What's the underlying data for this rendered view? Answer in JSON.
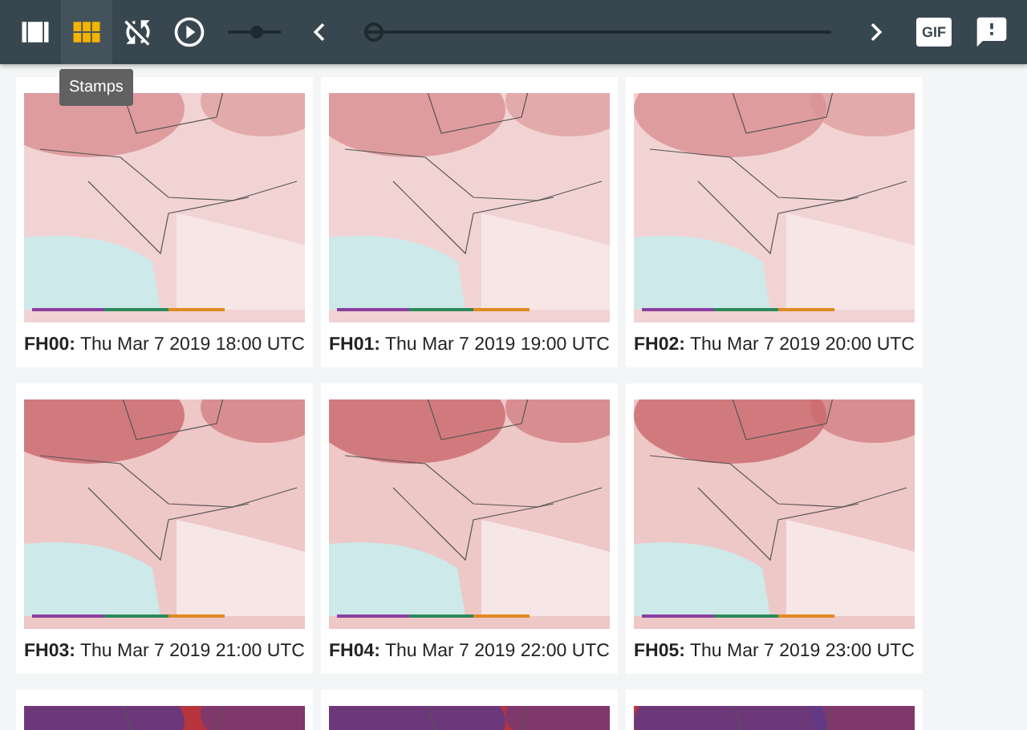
{
  "toolbar": {
    "buttons": [
      {
        "kind": "film",
        "selected": false
      },
      {
        "kind": "grid",
        "selected": true
      },
      {
        "kind": "sync",
        "selected": false
      },
      {
        "kind": "play",
        "selected": false
      }
    ],
    "speed_slider": {
      "level": 0.55
    },
    "timeline_slider": {
      "level": 0
    },
    "gif_button": {
      "label": "GIF"
    },
    "tooltip": "Stamps"
  },
  "stamps": [
    {
      "kind": "captioned",
      "caption": "**FH00:** Thu Mar 7 2019 18:00 UTC"
    },
    {
      "kind": "captioned",
      "caption": "**FH01:** Thu Mar 7 2019 19:00 UTC"
    },
    {
      "kind": "captioned",
      "caption": "**FH02:** Thu Mar 7 2019 20:00 UTC"
    },
    {
      "kind": "captioned",
      "caption": "**FH03:** Thu Mar 7 2019 21:00 UTC"
    },
    {
      "kind": "captioned",
      "caption": "**FH04:** Thu Mar 7 2019 22:00 UTC"
    },
    {
      "kind": "captioned",
      "caption": "**FH05:** Thu Mar 7 2019 23:00 UTC"
    },
    {
      "kind": "picture"
    },
    {
      "kind": "picture"
    },
    {
      "kind": "picture"
    }
  ]
}
